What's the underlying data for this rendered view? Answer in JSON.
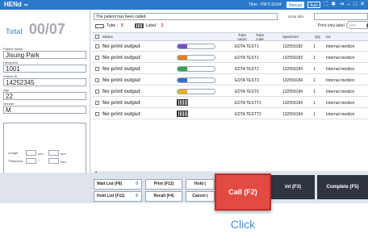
{
  "app": {
    "title": "HENd",
    "title_glyph": "∞",
    "time": "Time : PM 5:10:04",
    "mode_manual": "Manual",
    "mode_auto": "Auto"
  },
  "left": {
    "total_label": "Total",
    "total_count": "00/07",
    "patient_name_label": "Patient Name",
    "patient_name": "Jisung Park",
    "reception_label": "Reception",
    "reception": "1001",
    "patient_id_label": "Patient ID",
    "patient_id": "14252345",
    "age_label": "Age",
    "age": "22",
    "gender_label": "Gender",
    "gender": "M",
    "length_label": "Length",
    "length_unit": "mm",
    "thickness_label": "Thickness",
    "thickness_unit_deg": "°",
    "thickness_unit": "mm"
  },
  "main": {
    "message": "The patient has been called.",
    "scan_info_label": "Scan Info.",
    "tube_label": "Tube :",
    "tube_count": "5",
    "label_label": "Label :",
    "label_count": "2",
    "print_only_label": "Print only label",
    "toggle_state": "OFF"
  },
  "table": {
    "headers": [
      "Status",
      "Tube name",
      "Tube code",
      "Specimen",
      "Qty",
      "etc"
    ],
    "rows": [
      {
        "status": "No print output",
        "kind": "tube",
        "cap": "#7b4fc2",
        "tube_name": "EDTA TEST",
        "tube_code": "1",
        "specimen": "132559182",
        "qty": "1",
        "etc": "Internal medicin"
      },
      {
        "status": "No print output",
        "kind": "tube",
        "cap": "#e07f24",
        "tube_name": "EDTA TEST",
        "tube_code": "1",
        "specimen": "132559183",
        "qty": "1",
        "etc": "Internal medicin"
      },
      {
        "status": "No print output",
        "kind": "tube",
        "cap": "#34a35a",
        "tube_name": "EDTA TEST",
        "tube_code": "2",
        "specimen": "132559184",
        "qty": "1",
        "etc": "Internal medicin"
      },
      {
        "status": "No print output",
        "kind": "tube",
        "cap": "#3a6fc9",
        "tube_name": "EDTA TEST",
        "tube_code": "3",
        "specimen": "132559184",
        "qty": "1",
        "etc": "Internal medicin"
      },
      {
        "status": "No print output",
        "kind": "tube",
        "cap": "#e8b01e",
        "tube_name": "EDTA TEST",
        "tube_code": "5",
        "specimen": "132559184",
        "qty": "1",
        "etc": "Internal medicin"
      },
      {
        "status": "No print output",
        "kind": "label",
        "cap": "",
        "tube_name": "EDTA TEST",
        "tube_code": "T1",
        "specimen": "132559184",
        "qty": "1",
        "etc": "Internal medicin"
      },
      {
        "status": "No print output",
        "kind": "label",
        "cap": "",
        "tube_name": "EDTA TEST",
        "tube_code": "T2",
        "specimen": "132559184",
        "qty": "1",
        "etc": "Internal medicin"
      }
    ]
  },
  "bottom": {
    "wait_list": "Wait List (F8)",
    "wait_count": "0",
    "print": "Print (F12)",
    "hold_short": "Hold (",
    "hold_list": "Hold List (F11)",
    "hold_count": "0",
    "recall": "Recall (F4)",
    "cancel": "Cancel (",
    "reprint": "int (F3)",
    "complete": "Complete (F5)",
    "call": "Call (F2)"
  },
  "caption": "Click",
  "colors": {
    "accent": "#2a78c8",
    "call": "#e34a42",
    "count": "#d42a2a"
  }
}
